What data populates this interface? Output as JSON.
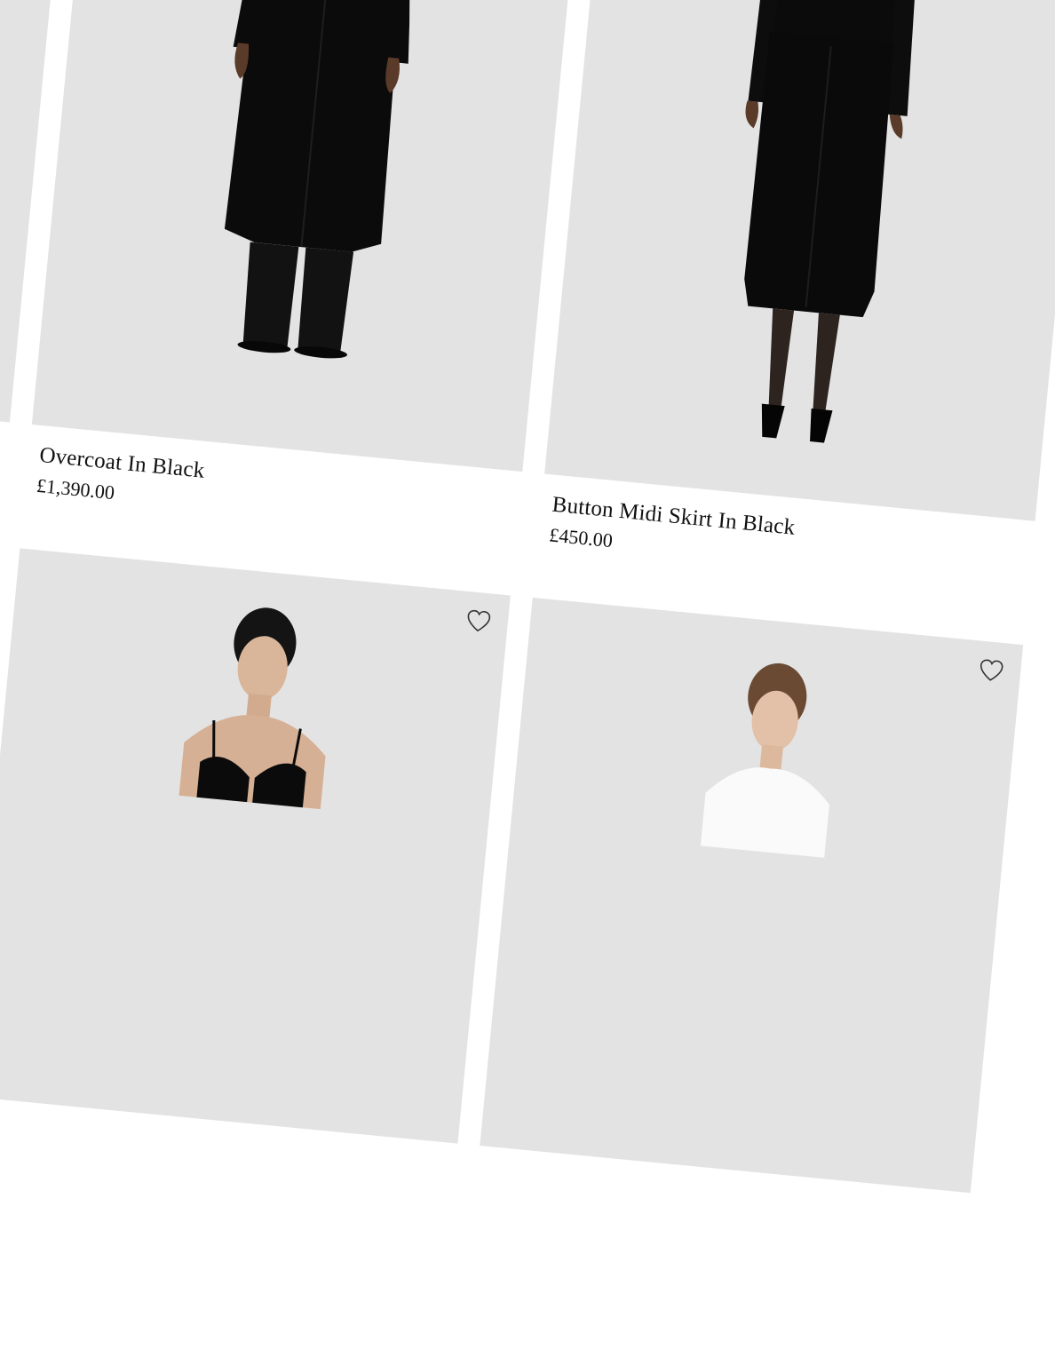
{
  "products": [
    {
      "title": "Overcoat In Black",
      "price": "£1,390.00"
    },
    {
      "title": "Button Midi Skirt In Black",
      "price": "£450.00"
    }
  ],
  "icons": {
    "wishlist": "heart-outline-icon"
  },
  "colors": {
    "tile_background": "#e3e3e3",
    "page_background": "#ffffff",
    "garment": "#0b0b0b"
  }
}
